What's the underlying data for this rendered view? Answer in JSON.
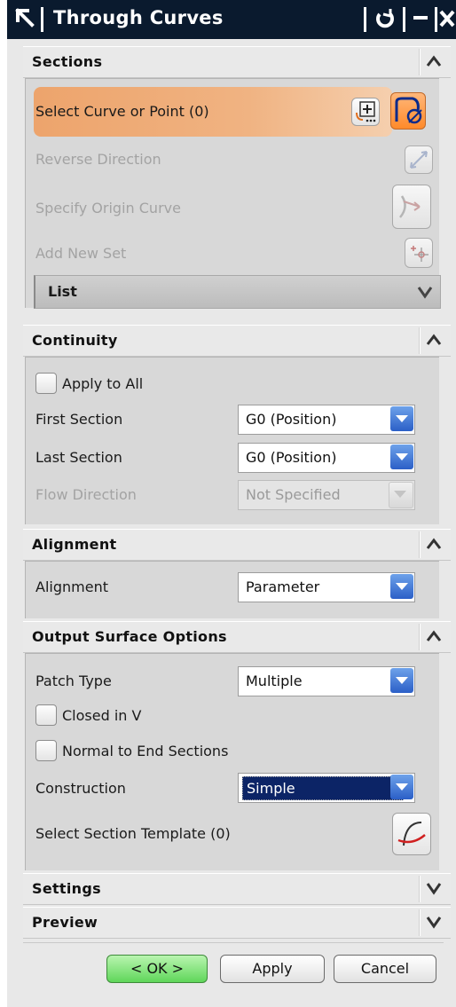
{
  "window": {
    "title": "Through Curves"
  },
  "sections": {
    "header": "Sections",
    "select_curve_label": "Select Curve or Point (0)",
    "reverse_direction_label": "Reverse Direction",
    "specify_origin_label": "Specify Origin Curve",
    "add_new_set_label": "Add New Set",
    "list_label": "List"
  },
  "continuity": {
    "header": "Continuity",
    "apply_all_label": "Apply to All",
    "first_section_label": "First Section",
    "first_section_value": "G0 (Position)",
    "last_section_label": "Last Section",
    "last_section_value": "G0 (Position)",
    "flow_direction_label": "Flow Direction",
    "flow_direction_value": "Not Specified"
  },
  "alignment": {
    "header": "Alignment",
    "alignment_label": "Alignment",
    "alignment_value": "Parameter"
  },
  "output": {
    "header": "Output Surface Options",
    "patch_type_label": "Patch Type",
    "patch_type_value": "Multiple",
    "closed_v_label": "Closed in V",
    "normal_end_label": "Normal to End Sections",
    "construction_label": "Construction",
    "construction_value": "Simple",
    "template_label": "Select Section Template (0)"
  },
  "settings": {
    "header": "Settings"
  },
  "preview": {
    "header": "Preview"
  },
  "buttons": {
    "ok": "< OK >",
    "apply": "Apply",
    "cancel": "Cancel"
  },
  "colors": {
    "titlebar": "#0a1a2e",
    "selection_highlight": "#eda46c",
    "combo_button": "#2b5fc7",
    "ok_button": "#5fd65a"
  }
}
